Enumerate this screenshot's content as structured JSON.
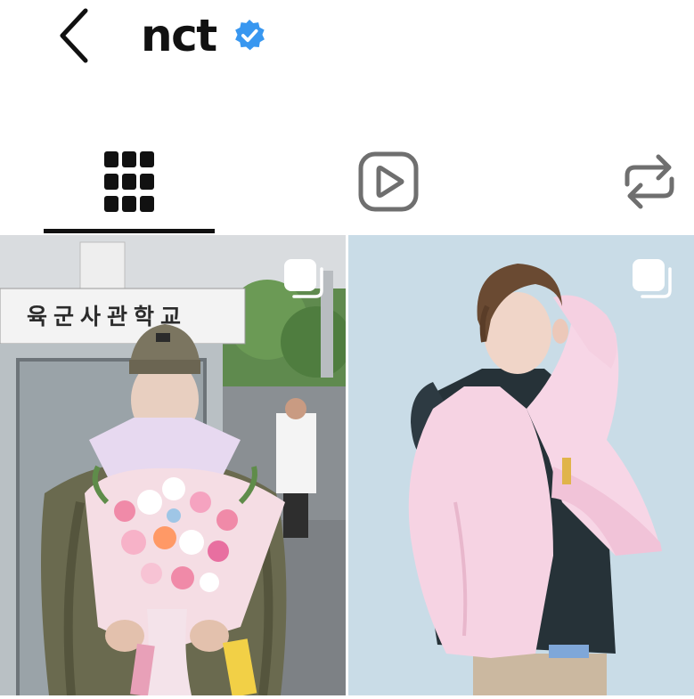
{
  "header": {
    "back_icon": "chevron-left-icon",
    "title": "nct",
    "verified_icon": "verified-badge-icon",
    "verified_color": "#3897f0"
  },
  "tabs": [
    {
      "name": "posts-grid",
      "icon": "grid-icon",
      "active": true
    },
    {
      "name": "reels",
      "icon": "reels-play-icon",
      "active": false
    },
    {
      "name": "reposts",
      "icon": "repost-icon",
      "active": false
    }
  ],
  "posts": [
    {
      "type": "carousel",
      "icon": "multiple-photos-icon",
      "sign_text": "육군사관학교"
    },
    {
      "type": "carousel",
      "icon": "multiple-photos-icon"
    }
  ],
  "colors": {
    "text": "#111111",
    "icon_gray": "#6f6f6f",
    "active_indicator": "#111111"
  }
}
